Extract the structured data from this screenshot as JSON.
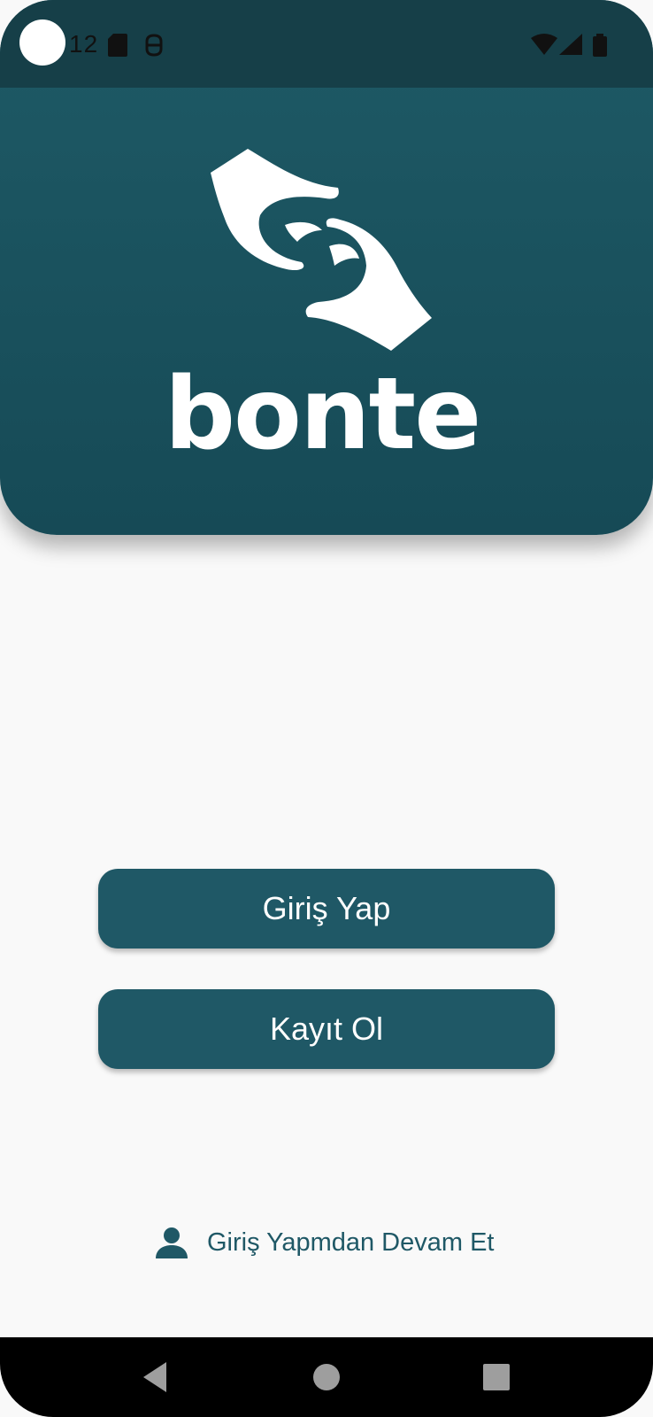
{
  "status_bar": {
    "time": "12",
    "icons": [
      "sd-card-icon",
      "debug-icon",
      "wifi-icon",
      "cellular-signal-icon",
      "battery-icon"
    ]
  },
  "header": {
    "logo_text": "bonte",
    "logo_icon": "hands-icon",
    "background_color": "#1e5a66"
  },
  "actions": {
    "login_label": "Giriş Yap",
    "register_label": "Kayıt Ol",
    "button_color": "#1f5866"
  },
  "guest": {
    "label": "Giriş Yapmdan Devam Et",
    "icon": "person-icon"
  },
  "navigation": {
    "back_icon": "back-triangle-icon",
    "home_icon": "home-circle-icon",
    "recents_icon": "recents-square-icon"
  }
}
